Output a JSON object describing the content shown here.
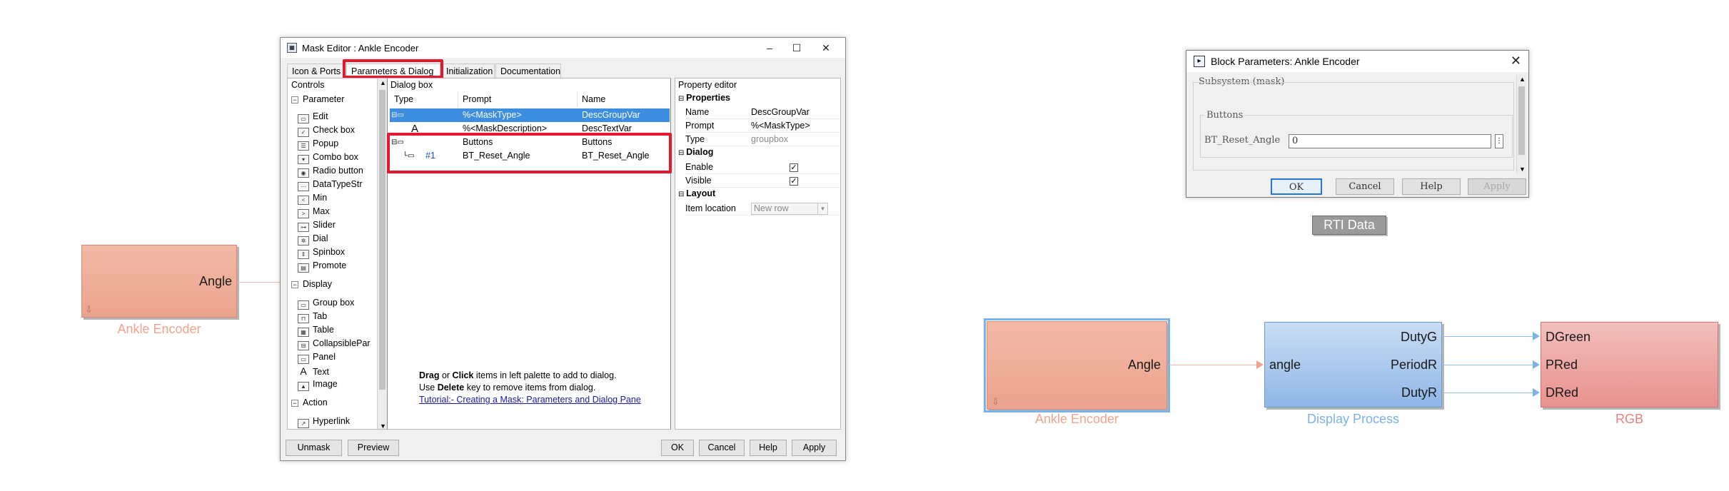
{
  "left_model": {
    "block": {
      "name": "Ankle Encoder",
      "output_port": "Angle"
    }
  },
  "mask_editor": {
    "title": "Mask Editor : Ankle Encoder",
    "window_buttons": {
      "minimize": "–",
      "maximize": "☐",
      "close": "✕"
    },
    "tabs": [
      {
        "label": "Icon & Ports",
        "active": false
      },
      {
        "label": "Parameters & Dialog",
        "active": true
      },
      {
        "label": "Initialization",
        "active": false
      },
      {
        "label": "Documentation",
        "active": false
      }
    ],
    "controls": {
      "header": "Controls",
      "groups": [
        {
          "label": "Parameter",
          "items": [
            "Edit",
            "Check box",
            "Popup",
            "Combo box",
            "Radio button",
            "DataTypeStr",
            "Min",
            "Max",
            "Slider",
            "Dial",
            "Spinbox",
            "Promote"
          ]
        },
        {
          "label": "Display",
          "items": [
            "Group box",
            "Tab",
            "Table",
            "CollapsiblePar",
            "Panel",
            "Text",
            "Image"
          ]
        },
        {
          "label": "Action",
          "items": [
            "Hyperlink"
          ]
        }
      ]
    },
    "dialog_box": {
      "header": "Dialog box",
      "columns": [
        "Type",
        "Prompt",
        "Name"
      ],
      "rows": [
        {
          "type": "",
          "number": "",
          "prompt": "%<MaskType>",
          "name": "DescGroupVar",
          "selected": true
        },
        {
          "type": "A",
          "number": "",
          "prompt": "%<MaskDescription>",
          "name": "DescTextVar",
          "selected": false
        },
        {
          "type": "",
          "number": "",
          "prompt": "Buttons",
          "name": "Buttons",
          "selected": false
        },
        {
          "type": "",
          "number": "#1",
          "prompt": "BT_Reset_Angle",
          "name": "BT_Reset_Angle",
          "selected": false
        }
      ],
      "help": {
        "line1_bold1": "Drag",
        "line1_mid": " or ",
        "line1_bold2": "Click",
        "line1_rest": " items in left palette to add to dialog.",
        "line2_pre": "Use ",
        "line2_bold": "Delete",
        "line2_rest": " key to remove items from dialog.",
        "link": "Tutorial:- Creating a Mask: Parameters and Dialog Pane"
      }
    },
    "property_editor": {
      "header": "Property editor",
      "sections": {
        "properties": {
          "label": "Properties",
          "rows": [
            {
              "key": "Name",
              "value": "DescGroupVar"
            },
            {
              "key": "Prompt",
              "value": "%<MaskType>"
            },
            {
              "key": "Type",
              "value": "groupbox"
            }
          ]
        },
        "dialog": {
          "label": "Dialog",
          "rows": [
            {
              "key": "Enable",
              "checked": true
            },
            {
              "key": "Visible",
              "checked": true
            }
          ]
        },
        "layout": {
          "label": "Layout",
          "rows": [
            {
              "key": "Item location",
              "value": "New row"
            }
          ]
        }
      }
    },
    "buttons": {
      "unmask": "Unmask",
      "preview": "Preview",
      "ok": "OK",
      "cancel": "Cancel",
      "help": "Help",
      "apply": "Apply"
    }
  },
  "block_parameters": {
    "title": "Block Parameters: Ankle Encoder",
    "subsystem_label": "Subsystem (mask)",
    "group_label": "Buttons",
    "field_label": "BT_Reset_Angle",
    "field_value": "0",
    "buttons": {
      "ok": "OK",
      "cancel": "Cancel",
      "help": "Help",
      "apply": "Apply"
    }
  },
  "rti_badge": "RTI Data",
  "right_model": {
    "encoder": {
      "name": "Ankle Encoder",
      "output_port": "Angle"
    },
    "display": {
      "name": "Display Process",
      "input_port": "angle",
      "output_ports": [
        "DutyG",
        "PeriodR",
        "DutyR"
      ]
    },
    "rgb": {
      "name": "RGB",
      "input_ports": [
        "DGreen",
        "PRed",
        "DRed"
      ]
    }
  },
  "colors": {
    "salmon_block": "#eba48e",
    "salmon_text": "#f2a48e",
    "blue_block": "#8fb6e6",
    "blue_text": "#7cb2ec",
    "red_block": "#e8918d",
    "red_text": "#e8807c",
    "highlight_red": "#e3192f",
    "selection_blue": "#3d8ee0"
  }
}
